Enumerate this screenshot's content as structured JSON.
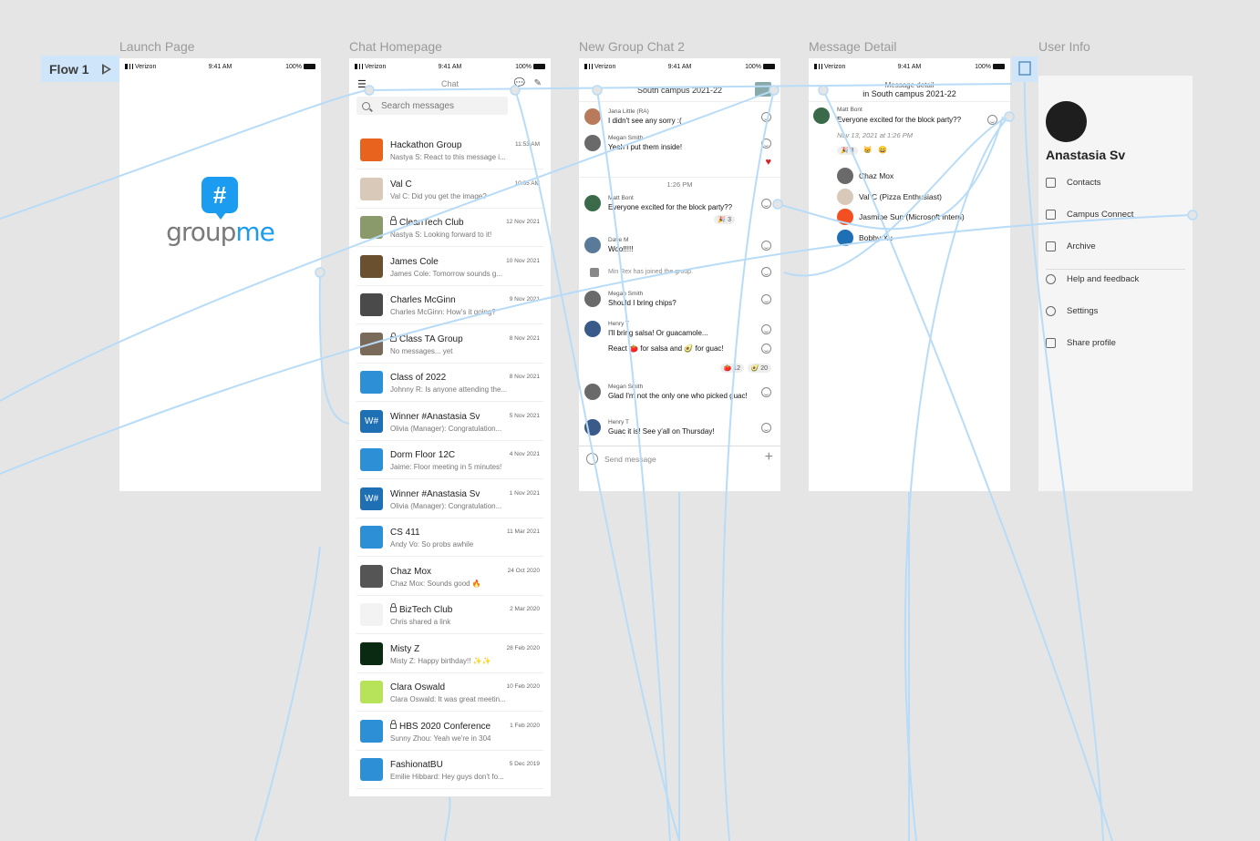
{
  "flow": {
    "label": "Flow 1"
  },
  "frames": {
    "launch": "Launch Page",
    "home": "Chat Homepage",
    "group": "New Group Chat 2",
    "detail": "Message Detail",
    "user": "User Info"
  },
  "status": {
    "carrier": "Verizon",
    "time": "9:41 AM",
    "battery": "100%"
  },
  "launch": {
    "word1": "group",
    "word2": "me",
    "logo_glyph": "#"
  },
  "home": {
    "title": "Chat",
    "search_placeholder": "Search messages",
    "chats": [
      {
        "name": "Hackathon Group",
        "preview": "Nastya S: React to this message i...",
        "time": "11:53 AM",
        "color": "#e8641e",
        "locked": false
      },
      {
        "name": "Val C",
        "preview": "Val C: Did you get the image?",
        "time": "10:05 AM",
        "color": "#d9c9b8",
        "locked": false
      },
      {
        "name": "CleanTech Club",
        "preview": "Nastya S: Looking forward to it!",
        "time": "12 Nov 2021",
        "color": "#8a9a6a",
        "locked": true
      },
      {
        "name": "James Cole",
        "preview": "James Cole: Tomorrow sounds g...",
        "time": "10 Nov 2021",
        "color": "#6b5030",
        "locked": false
      },
      {
        "name": "Charles McGinn",
        "preview": "Charles McGinn: How's it going?",
        "time": "9 Nov 2021",
        "color": "#4a4a4a",
        "locked": false
      },
      {
        "name": "Class TA Group",
        "preview": "No messages... yet",
        "time": "8 Nov 2021",
        "color": "#7a6a5a",
        "locked": true
      },
      {
        "name": "Class of 2022",
        "preview": "Johnny R: Is anyone attending the...",
        "time": "8 Nov 2021",
        "color": "#2d8fd5",
        "locked": false
      },
      {
        "name": "Winner #Anastasia Sv",
        "preview": "Olivia (Manager): Congratulation...",
        "time": "5 Nov 2021",
        "color": "#1f6fb5",
        "locked": false
      },
      {
        "name": "Dorm Floor 12C",
        "preview": "Jaime: Floor meeting in 5 minutes!",
        "time": "4 Nov 2021",
        "color": "#2d8fd5",
        "locked": false
      },
      {
        "name": "Winner #Anastasia Sv",
        "preview": "Olivia (Manager): Congratulation...",
        "time": "1 Nov 2021",
        "color": "#1f6fb5",
        "locked": false
      },
      {
        "name": "CS 411",
        "preview": "Andy Vo: So probs awhile",
        "time": "11 Mar 2021",
        "color": "#2d8fd5",
        "locked": false
      },
      {
        "name": "Chaz Mox",
        "preview": "Chaz Mox: Sounds good 🔥",
        "time": "24 Oct 2020",
        "color": "#555555",
        "locked": false
      },
      {
        "name": "BizTech Club",
        "preview": "Chris shared a link",
        "time": "2 Mar 2020",
        "color": "#f3f3f3",
        "locked": true
      },
      {
        "name": "Misty Z",
        "preview": "Misty Z: Happy birthday!! ✨✨",
        "time": "28 Feb 2020",
        "color": "#0b2a12",
        "locked": false
      },
      {
        "name": "Clara Oswald",
        "preview": "Clara Oswald: It was great meetin...",
        "time": "10 Feb 2020",
        "color": "#b7e35a",
        "locked": false
      },
      {
        "name": "HBS 2020 Conference",
        "preview": "Sunny Zhou: Yeah we're in 304",
        "time": "1 Feb 2020",
        "color": "#2d8fd5",
        "locked": true
      },
      {
        "name": "FashionatBU",
        "preview": "Emilie Hibbard: Hey guys don't fo...",
        "time": "5 Dec 2019",
        "color": "#2d8fd5",
        "locked": false
      }
    ],
    "winner_glyph": "W#"
  },
  "group": {
    "title": "South campus 2021-22",
    "divider_time": "1:26 PM",
    "messages": [
      {
        "who": "Jana Little (RA)",
        "text": "I didn't see any sorry :(",
        "color": "#b87a5a"
      },
      {
        "who": "Megan Smith",
        "text": "Yeah I put them inside!",
        "color": "#6a6a6a"
      },
      {
        "who": "Matt Bont",
        "text": "Everyone excited for the block party??",
        "color": "#3a6a4a"
      },
      {
        "who": "Dave M",
        "text": "Woo!!!!!",
        "color": "#5a7a9a"
      },
      {
        "who": "",
        "text": "Min Rex has joined the group.",
        "color": "#999999"
      },
      {
        "who": "Megan Smith",
        "text": "Should I bring chips?",
        "color": "#6a6a6a"
      },
      {
        "who": "Henry T",
        "text": "I'll bring salsa! Or guacamole...",
        "color": "#3a5a8a"
      },
      {
        "who": "",
        "text": "React 🍅 for salsa and 🥑 for guac!",
        "color": "#3a5a8a"
      },
      {
        "who": "Megan Smith",
        "text": "Glad I'm not the only one who picked guac!",
        "color": "#6a6a6a"
      },
      {
        "who": "Henry T",
        "text": "Guac it is! See y'all on Thursday!",
        "color": "#3a5a8a"
      }
    ],
    "reacts": {
      "party": "3",
      "salsa": "12",
      "guac": "20"
    },
    "send_placeholder": "Send message",
    "plus": "+"
  },
  "detail": {
    "title": "Message detail",
    "subtitle": "in South campus 2021-22",
    "who": "Matt Bont",
    "text": "Everyone excited for the block party??",
    "timestamp": "Nov 13, 2021 at 1:26 PM",
    "react_count": "3",
    "people": [
      "Chaz Mox",
      "Val C (Pizza Enthusiast)",
      "Jasmine Sun (Microsoft Intern)",
      "Bobby Xu"
    ]
  },
  "user": {
    "name": "Anastasia Sv",
    "items": [
      "Contacts",
      "Campus Connect",
      "Archive",
      "Help and feedback",
      "Settings",
      "Share profile"
    ]
  }
}
